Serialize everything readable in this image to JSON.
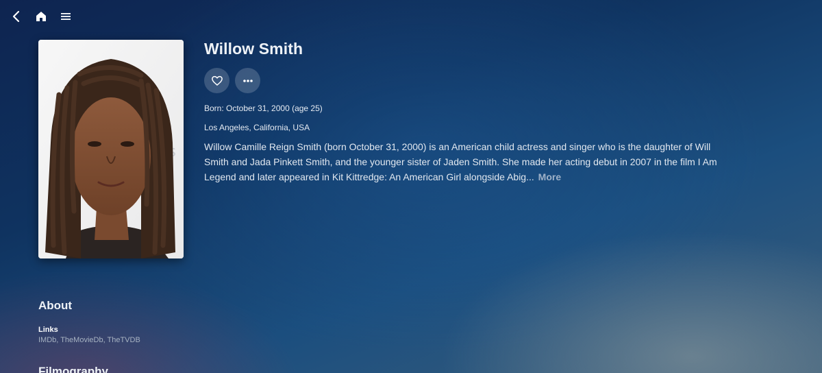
{
  "header": {
    "icons": [
      "back-arrow-icon",
      "home-icon",
      "menu-icon"
    ]
  },
  "person": {
    "name": "Willow Smith",
    "born": "Born: October 31, 2000 (age 25)",
    "birthplace": "Los Angeles, California, USA",
    "overview": "Willow Camille Reign Smith (born October 31, 2000) is an American child actress and singer who is the daughter of Will Smith and Jada Pinkett Smith, and the younger sister of Jaden Smith. She made her acting debut in 2007 in the film I Am Legend and later appeared in Kit Kittredge: An American Girl alongside Abig...",
    "more_label": "More",
    "actions": {
      "favorite_icon": "heart-icon",
      "more_icon": "more-horizontal-icon"
    }
  },
  "about": {
    "title": "About",
    "links_label": "Links",
    "links": [
      "IMDb",
      "TheMovieDb",
      "TheTVDB"
    ],
    "separator": ", "
  },
  "filmography": {
    "title": "Filmography"
  }
}
